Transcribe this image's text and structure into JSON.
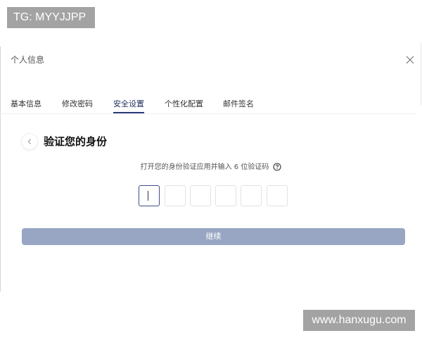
{
  "overlays": {
    "tg_label": "TG: MYYJJPP",
    "site_label": "www.hanxugu.com"
  },
  "dialog": {
    "title": "个人信息",
    "close_icon": "close-icon"
  },
  "tabs": [
    {
      "label": "基本信息",
      "active": false
    },
    {
      "label": "修改密码",
      "active": false
    },
    {
      "label": "安全设置",
      "active": true
    },
    {
      "label": "个性化配置",
      "active": false
    },
    {
      "label": "邮件签名",
      "active": false
    }
  ],
  "verify": {
    "back_icon": "chevron-left-icon",
    "title": "验证您的身份",
    "instruction": "打开您的身份验证应用并输入 6 位验证码",
    "help_icon": "question-circle-icon",
    "code_digits": [
      "",
      "",
      "",
      "",
      "",
      ""
    ],
    "continue_label": "继续"
  },
  "colors": {
    "accent": "#2b3d77",
    "button_disabled": "#98a6c4"
  }
}
